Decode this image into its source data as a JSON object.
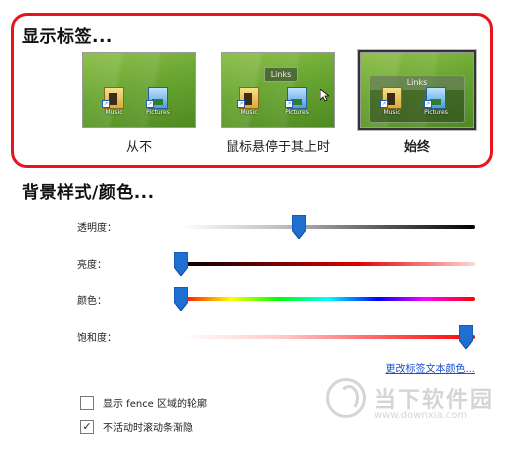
{
  "display_labels": {
    "heading": "显示标签...",
    "options": [
      {
        "caption": "从不",
        "fence_title": "",
        "hover_tab": "",
        "selected": false
      },
      {
        "caption": "鼠标悬停于其上时",
        "fence_title": "",
        "hover_tab": "Links",
        "selected": false
      },
      {
        "caption": "始终",
        "fence_title": "Links",
        "hover_tab": "",
        "selected": true
      }
    ],
    "icons": [
      {
        "name": "folder-icon",
        "label": "Music"
      },
      {
        "name": "pictures-icon",
        "label": "Pictures"
      }
    ]
  },
  "background": {
    "heading": "背景样式/颜色...",
    "sliders": [
      {
        "label": "透明度：",
        "level": 0.4
      },
      {
        "label": "亮度：",
        "level": 0.0
      },
      {
        "label": "颜色：",
        "level": 0.0
      },
      {
        "label": "饱和度：",
        "level": 0.97
      }
    ],
    "change_text_color_link": "更改标签文本颜色..."
  },
  "checkboxes": [
    {
      "label": "显示 fence 区域的轮廓",
      "checked": false
    },
    {
      "label": "不活动时滚动条渐隐",
      "checked": true
    }
  ],
  "watermark": {
    "text": "当下软件园",
    "url": "www.downxia.com"
  },
  "colors": {
    "frame_red": "#e8141c",
    "slider_blue": "#1e6fd0",
    "link_blue": "#1a4fcf"
  }
}
